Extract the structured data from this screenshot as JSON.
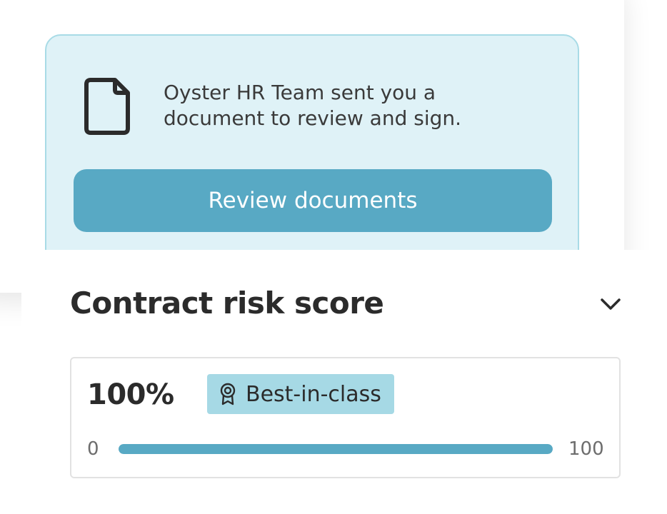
{
  "notification": {
    "icon": "document-icon",
    "message": "Oyster HR Team sent you a document to review and sign.",
    "button_label": "Review documents"
  },
  "risk_panel": {
    "title": "Contract risk score",
    "expand_icon": "chevron-down-icon",
    "score_text": "100%",
    "score_fraction": 1.0,
    "badge": {
      "icon": "award-ribbon-icon",
      "label": "Best-in-class"
    },
    "range_min": "0",
    "range_max": "100"
  },
  "colors": {
    "accent": "#58a9c4",
    "notice_background": "#dff2f7",
    "badge_background": "#a6d9e5"
  }
}
